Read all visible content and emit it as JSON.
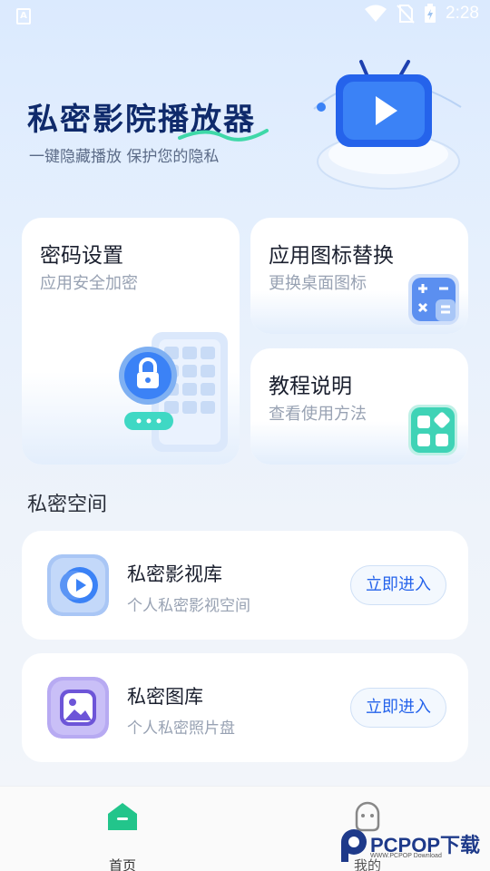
{
  "status_bar": {
    "time": "2:28"
  },
  "hero": {
    "title": "私密影院播放器",
    "subtitle": "一键隐藏播放 保护您的隐私"
  },
  "cards": {
    "password": {
      "title": "密码设置",
      "subtitle": "应用安全加密"
    },
    "icon_replace": {
      "title": "应用图标替换",
      "subtitle": "更换桌面图标"
    },
    "tutorial": {
      "title": "教程说明",
      "subtitle": "查看使用方法"
    }
  },
  "private_space": {
    "title": "私密空间",
    "items": [
      {
        "title": "私密影视库",
        "subtitle": "个人私密影视空间",
        "button": "立即进入",
        "icon": "video-play-icon"
      },
      {
        "title": "私密图库",
        "subtitle": "个人私密照片盘",
        "button": "立即进入",
        "icon": "gallery-icon"
      }
    ]
  },
  "bottom_nav": {
    "home": "首页",
    "mine": "我的"
  },
  "watermark": {
    "brand": "PCPOP下载",
    "small": "WWW.PCPOP Download"
  },
  "colors": {
    "accent": "#2563eb",
    "title": "#0f2a6b",
    "green": "#34d3a5"
  }
}
